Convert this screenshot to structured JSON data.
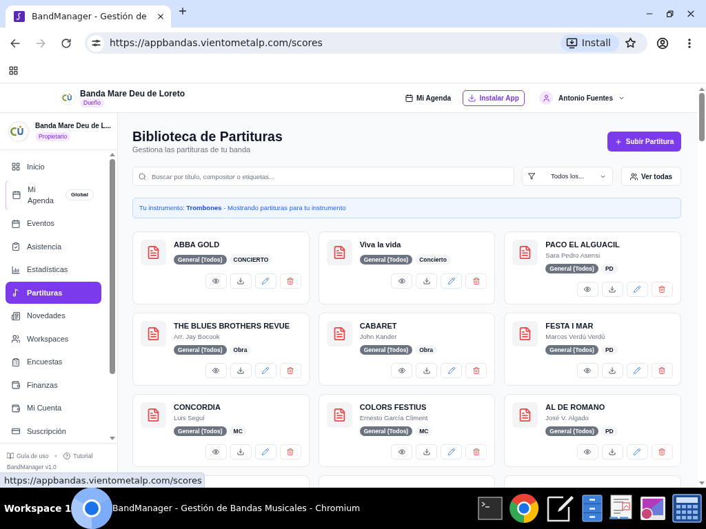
{
  "browser": {
    "tab_title": "BandManager - Gestión de",
    "url": "https://appbandas.vientometalp.com/scores",
    "install_button": "Install"
  },
  "header": {
    "band_name": "Banda Mare Deu de Loreto",
    "role_badge": "Dueño",
    "agenda_link": "Mi Agenda",
    "install_button": "Instalar App",
    "user_name": "Antonio Fuentes"
  },
  "sidebar": {
    "band_name": "Banda Mare Deu de L...",
    "role_badge": "Propietario",
    "items": [
      {
        "label": "Inicio",
        "selected": false
      },
      {
        "label": "Mi Agenda",
        "badge": "Global",
        "selected": false
      },
      {
        "label": "Eventos",
        "selected": false
      },
      {
        "label": "Asistencia",
        "selected": false
      },
      {
        "label": "Estadísticas",
        "selected": false
      },
      {
        "label": "Partituras",
        "selected": true
      },
      {
        "label": "Novedades",
        "selected": false
      },
      {
        "label": "Workspaces",
        "selected": false
      },
      {
        "label": "Encuestas",
        "selected": false
      },
      {
        "label": "Finanzas",
        "selected": false
      },
      {
        "label": "Mi Cuenta",
        "selected": false
      },
      {
        "label": "Suscripción",
        "selected": false
      }
    ],
    "footer_links": [
      "Guía de uso",
      "Tutorial"
    ],
    "version": "BandManager v1.0"
  },
  "page": {
    "title": "Biblioteca de Partituras",
    "subtitle": "Gestiona las partituras de tu banda",
    "upload_button": "Subir Partitura",
    "search": {
      "placeholder": "Buscar por título, compositor o etiquetas..."
    },
    "filter": {
      "value": "Todos los..."
    },
    "view_all_button": "Ver todas",
    "notice": "Tu instrumento: **Trombones** - Mostrando partituras para tu instrumento"
  },
  "scores": [
    {
      "title": "ABBA GOLD",
      "tags": [
        {
          "label": "General (Todos)",
          "kind": "instrument"
        },
        {
          "label": "CONCIERTO",
          "kind": "category"
        }
      ]
    },
    {
      "title": "Viva la vida",
      "tags": [
        {
          "label": "General (Todos)",
          "kind": "instrument"
        },
        {
          "label": "Concierto",
          "kind": "category"
        }
      ]
    },
    {
      "title": "PACO EL ALGUACIL",
      "composer": "Sara Pedro Asensi",
      "tags": [
        {
          "label": "General (Todos)",
          "kind": "instrument"
        },
        {
          "label": "PD",
          "kind": "category"
        }
      ]
    },
    {
      "title": "THE BLUES BROTHERS REVUE",
      "composer": "Arr. Jay Bocook",
      "tags": [
        {
          "label": "General (Todos)",
          "kind": "instrument"
        },
        {
          "label": "Obra",
          "kind": "category"
        }
      ]
    },
    {
      "title": "CABARET",
      "composer": "John Kander",
      "tags": [
        {
          "label": "General (Todos)",
          "kind": "instrument"
        },
        {
          "label": "Obra",
          "kind": "category"
        }
      ]
    },
    {
      "title": "FESTA I MAR",
      "composer": "Marcos Verdú Verdú",
      "tags": [
        {
          "label": "General (Todos)",
          "kind": "instrument"
        },
        {
          "label": "PD",
          "kind": "category"
        }
      ]
    },
    {
      "title": "CONCORDIA",
      "composer": "Luis Seguí",
      "tags": [
        {
          "label": "General (Todos)",
          "kind": "instrument"
        },
        {
          "label": "MC",
          "kind": "category"
        }
      ]
    },
    {
      "title": "COLORS FESTIUS",
      "composer": "Ernesto García Climent",
      "tags": [
        {
          "label": "General (Todos)",
          "kind": "instrument"
        },
        {
          "label": "MC",
          "kind": "category"
        }
      ]
    },
    {
      "title": "AL DE ROMANO",
      "composer": "José V. Algado",
      "tags": [
        {
          "label": "General (Todos)",
          "kind": "instrument"
        },
        {
          "label": "PD",
          "kind": "category"
        }
      ]
    }
  ],
  "status_url": "https://appbandas.vientometalp.com/scores",
  "taskbar": {
    "workspace": "Workspace 1",
    "window_title": "BandManager - Gestión de Bandas Musicales - Chromium"
  }
}
